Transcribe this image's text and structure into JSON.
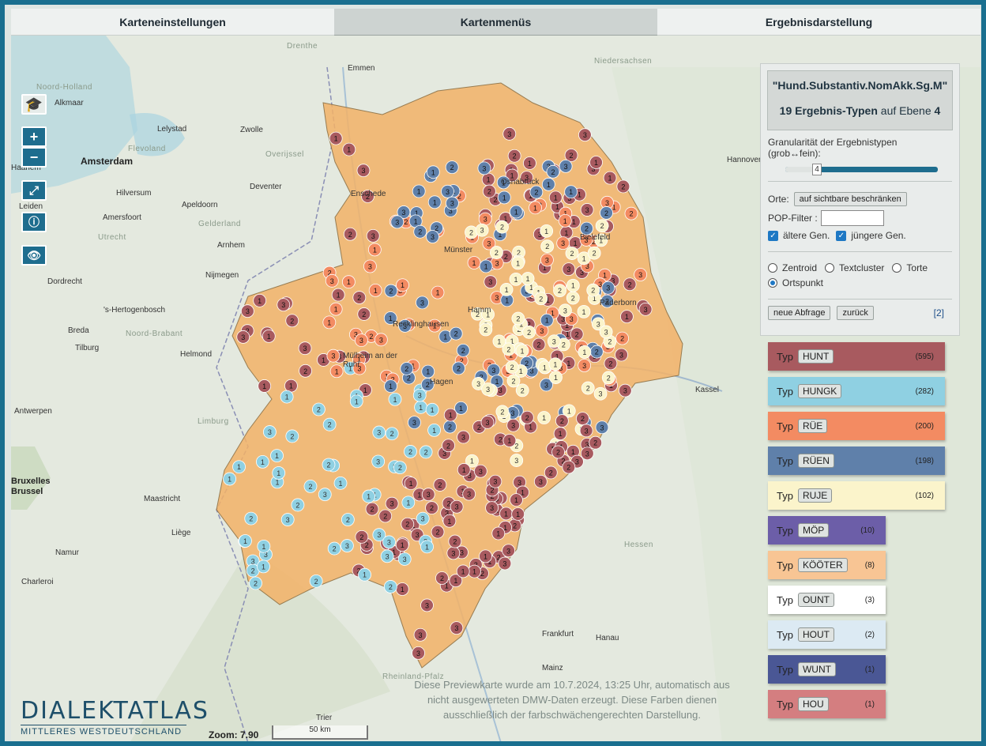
{
  "tabs": [
    "Karteneinstellungen",
    "Kartenmenüs",
    "Ergebnisdarstellung"
  ],
  "query": "\"Hund.Substantiv.NomAkk.Sg.M\"",
  "result_count": "19 Ergebnis-Typen",
  "result_level_text": "auf Ebene",
  "result_level": "4",
  "granularity_label": "Granularität der Ergebnistypen (grob↔fein):",
  "granularity_value": "4",
  "orte_label": "Orte:",
  "orte_button": "auf sichtbare beschränken",
  "pop_label": "POP-Filter :",
  "pop_value": "",
  "check_old": "ältere Gen.",
  "check_young": "jüngere Gen.",
  "radios": [
    "Zentroid",
    "Textcluster",
    "Torte",
    "Ortspunkt"
  ],
  "btn_new": "neue Abfrage",
  "btn_back": "zurück",
  "footnote": "[2]",
  "legend": [
    {
      "tag": "HUNT",
      "count": "(595)",
      "color": "#a85a5f",
      "width": 224
    },
    {
      "tag": "HUNGK",
      "count": "(282)",
      "color": "#8fd0e2",
      "width": 224
    },
    {
      "tag": "RÜE",
      "count": "(200)",
      "color": "#f38b62",
      "width": 224
    },
    {
      "tag": "RÜEN",
      "count": "(198)",
      "color": "#5f80aa",
      "width": 224
    },
    {
      "tag": "RUJE",
      "count": "(102)",
      "color": "#fbf4cb",
      "width": 224
    },
    {
      "tag": "MÖP",
      "count": "(10)",
      "color": "#6c5ea8",
      "width": 149
    },
    {
      "tag": "KÖÖTER",
      "count": "(8)",
      "color": "#f8c594",
      "width": 149
    },
    {
      "tag": "OUNT",
      "count": "(3)",
      "color": "#ffffff",
      "width": 149
    },
    {
      "tag": "HOUT",
      "count": "(2)",
      "color": "#dceaf3",
      "width": 149
    },
    {
      "tag": "WUNT",
      "count": "(1)",
      "color": "#4a5795",
      "width": 149
    },
    {
      "tag": "HOU",
      "count": "(1)",
      "color": "#d47e80",
      "width": 149
    }
  ],
  "typ_label": "Typ",
  "places": [
    {
      "name": "Emmen"
    },
    {
      "name": "Drenthe"
    },
    {
      "name": "Noord-Holland"
    },
    {
      "name": "Alkmaar"
    },
    {
      "name": "Lelystad"
    },
    {
      "name": "Zwolle"
    },
    {
      "name": "Flevoland"
    },
    {
      "name": "Overijssel"
    },
    {
      "name": "Amsterdam"
    },
    {
      "name": "Haarlem"
    },
    {
      "name": "Hilversum"
    },
    {
      "name": "Deventer"
    },
    {
      "name": "Leiden"
    },
    {
      "name": "Amersfoort"
    },
    {
      "name": "Apeldoorn"
    },
    {
      "name": "Enschede"
    },
    {
      "name": "Gelderland"
    },
    {
      "name": "Utrecht"
    },
    {
      "name": "Arnhem"
    },
    {
      "name": "Nijmegen"
    },
    {
      "name": "Dordrecht"
    },
    {
      "name": "'s-Hertogenbosch"
    },
    {
      "name": "Breda"
    },
    {
      "name": "Tilburg"
    },
    {
      "name": "Noord-Brabant"
    },
    {
      "name": "Helmond"
    },
    {
      "name": "Antwerpen"
    },
    {
      "name": "Limburg"
    },
    {
      "name": "Bruxelles"
    },
    {
      "name": "Brussel"
    },
    {
      "name": "Maastricht"
    },
    {
      "name": "Liège"
    },
    {
      "name": "Namur"
    },
    {
      "name": "Charleroi"
    },
    {
      "name": "Niedersachsen"
    },
    {
      "name": "Hannover"
    },
    {
      "name": "Osnabrück"
    },
    {
      "name": "Bielefeld"
    },
    {
      "name": "Münster"
    },
    {
      "name": "Hamm"
    },
    {
      "name": "Paderborn"
    },
    {
      "name": "Recklinghausen"
    },
    {
      "name": "Mülheim an der Ruhr"
    },
    {
      "name": "Hagen"
    },
    {
      "name": "Kassel"
    },
    {
      "name": "Hessen"
    },
    {
      "name": "Trier"
    },
    {
      "name": "Frankfurt"
    },
    {
      "name": "Hanau"
    },
    {
      "name": "Mainz"
    },
    {
      "name": "Rheinland-Pfalz"
    }
  ],
  "notice": "Diese Previewkarte wurde am 10.7.2024, 13:25 Uhr, automatisch aus nicht ausgewerteten DMW-Daten erzeugt. Diese Farben dienen ausschließlich der farbschwächengerechten Darstellung.",
  "logo_title": "DIALEKTATLAS",
  "logo_sub": "MITTLERES WESTDEUTSCHLAND",
  "zoom_text": "Zoom: 7.90",
  "scale_text": "50 km",
  "region_color": "#f3b268"
}
